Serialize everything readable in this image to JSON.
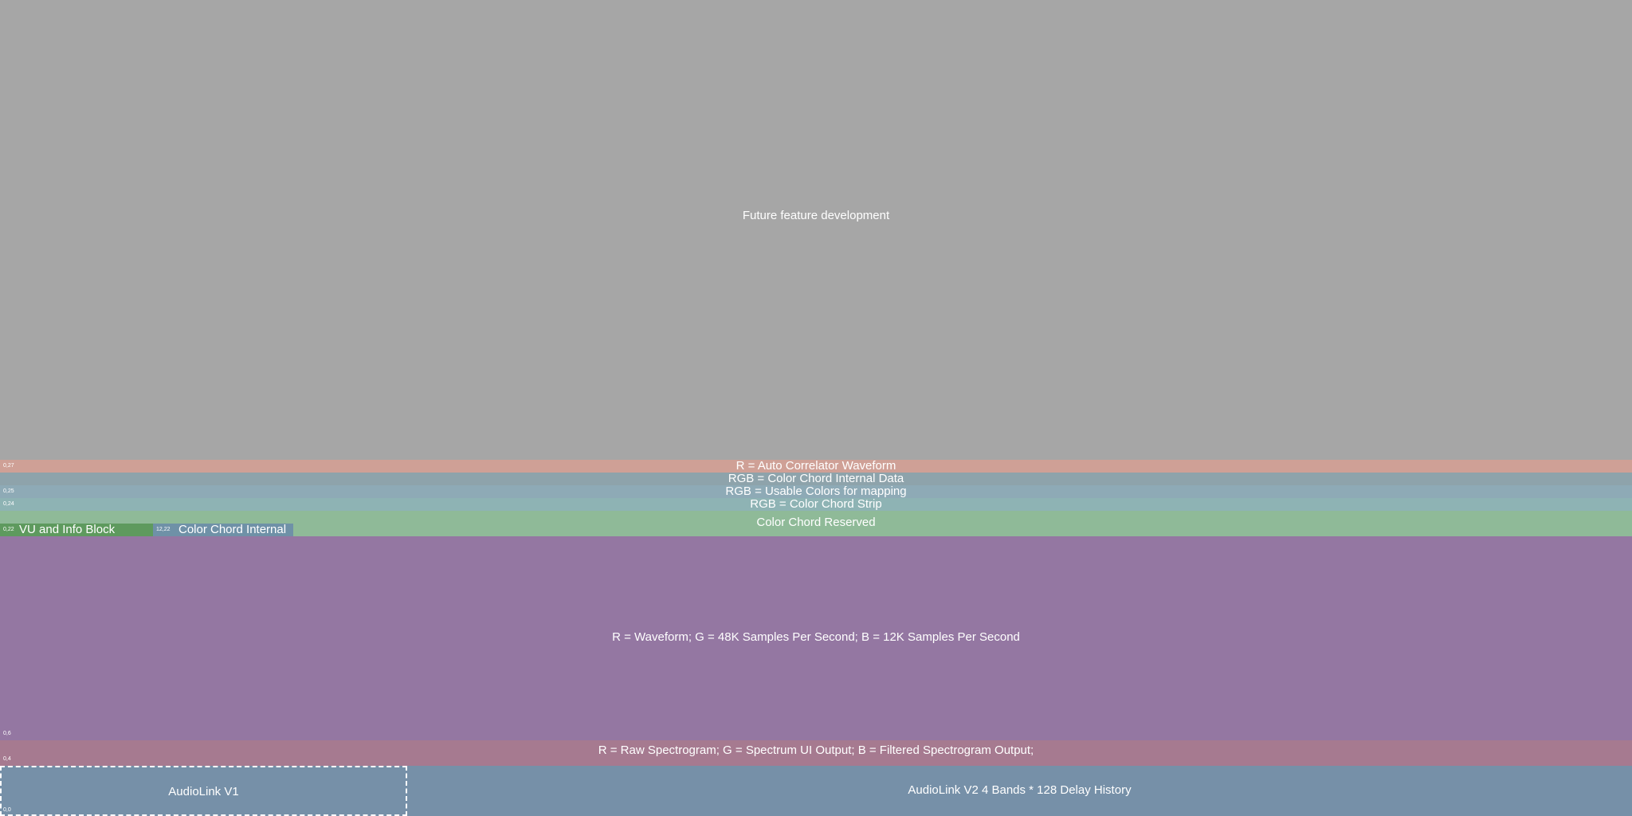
{
  "future": {
    "label": "Future feature development"
  },
  "autocorrelator": {
    "label": "R = Auto Correlator Waveform",
    "coord": "0,27"
  },
  "color_chord_internal_data": {
    "label": "RGB = Color Chord Internal Data"
  },
  "usable_colors": {
    "label": "RGB = Usable Colors for mapping",
    "coord": "0,25"
  },
  "color_chord_strip": {
    "label": "RGB = Color Chord Strip",
    "coord": "0,24"
  },
  "color_chord_reserved": {
    "label": "Color Chord Reserved"
  },
  "vu_block": {
    "label": "VU and Info Block",
    "coord": "0,22"
  },
  "color_chord_internal_block": {
    "label": "Color Chord Internal",
    "coord": "12,22"
  },
  "waveform": {
    "label": "R = Waveform; G = 48K Samples Per Second; B = 12K Samples Per Second",
    "coord": "0,6"
  },
  "spectrogram": {
    "label": "R = Raw Spectrogram; G = Spectrum UI Output; B = Filtered Spectrogram Output;",
    "coord": "0,4"
  },
  "audiolink_v1": {
    "label": "AudioLink V1"
  },
  "audiolink_v2": {
    "label": "AudioLink V2 4 Bands * 128 Delay History"
  },
  "origin": {
    "coord": "0,0"
  },
  "colors": {
    "future": "#a6a6a6",
    "autocorrelator": "#cfa096",
    "color_chord_internal_data": "#8ea3ab",
    "usable_colors": "#8eaab6",
    "color_chord_strip": "#8eb3b4",
    "color_chord_reserved": "#8fba98",
    "vu_block": "#5e9a5e",
    "color_chord_internal_block": "#6f91a7",
    "waveform": "#9477a2",
    "spectrogram": "#a67a90",
    "audiolink": "#7690a8"
  }
}
